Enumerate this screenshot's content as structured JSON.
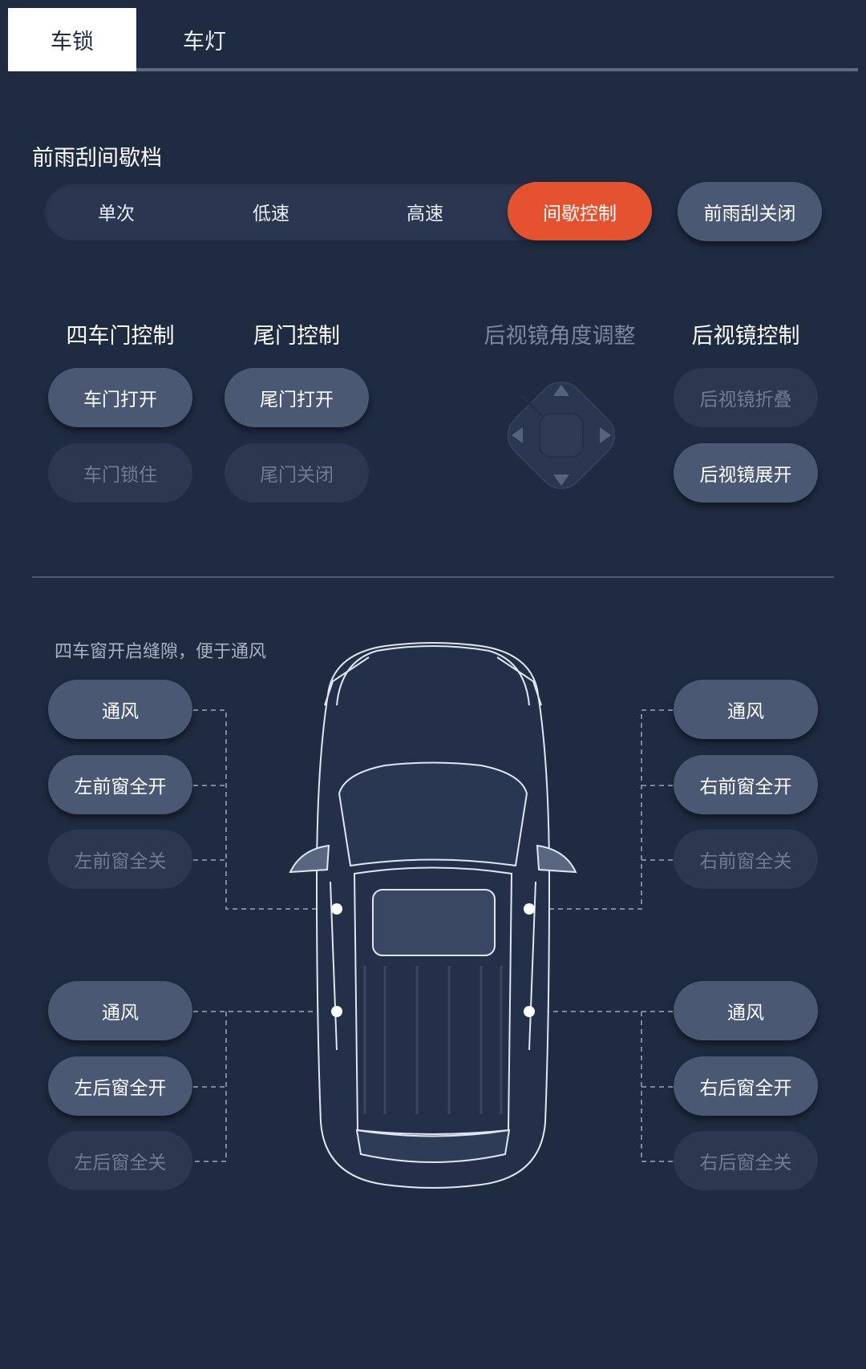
{
  "tabs": {
    "active": "车锁",
    "inactive": "车灯"
  },
  "wiper": {
    "title": "前雨刮间歇档",
    "modes": [
      "单次",
      "低速",
      "高速",
      "间歇控制"
    ],
    "selected": "间歇控制",
    "off_button": "前雨刮关闭"
  },
  "doors": {
    "title": "四车门控制",
    "open": "车门打开",
    "lock": "车门锁住"
  },
  "tailgate": {
    "title": "尾门控制",
    "open": "尾门打开",
    "close": "尾门关闭"
  },
  "mirror_adjust": {
    "title": "后视镜角度调整"
  },
  "mirror_control": {
    "title": "后视镜控制",
    "fold": "后视镜折叠",
    "unfold": "后视镜展开"
  },
  "windows": {
    "hint": "四车窗开启缝隙，便于通风",
    "front_left": {
      "vent": "通风",
      "open": "左前窗全开",
      "close": "左前窗全关"
    },
    "front_right": {
      "vent": "通风",
      "open": "右前窗全开",
      "close": "右前窗全关"
    },
    "rear_left": {
      "vent": "通风",
      "open": "左后窗全开",
      "close": "左后窗全关"
    },
    "rear_right": {
      "vent": "通风",
      "open": "右后窗全开",
      "close": "右后窗全关"
    }
  },
  "colors": {
    "accent": "#e5522f",
    "background": "#1f2b41",
    "button": "#4a5873",
    "button_disabled": "#2c3850"
  }
}
